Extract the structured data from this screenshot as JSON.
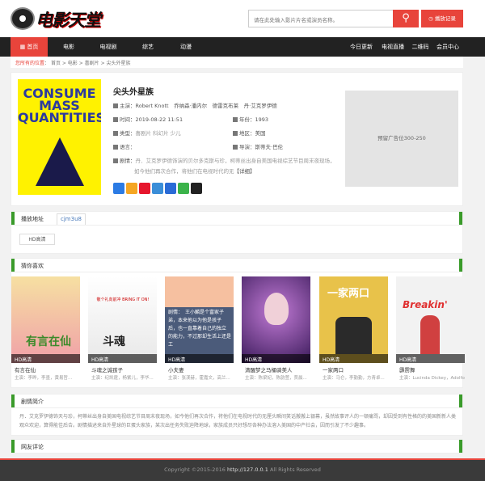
{
  "header": {
    "logo_text": "电影天堂",
    "search_placeholder": "请在此处输入影片片名或演员名称。",
    "history_label": "播放记录"
  },
  "nav": {
    "left": [
      "首页",
      "电影",
      "电视剧",
      "综艺",
      "动漫"
    ],
    "right": [
      "今日更新",
      "电视直播",
      "二维码",
      "会员中心"
    ]
  },
  "breadcrumb": {
    "lead": "您所有的位置",
    "items": [
      "首页",
      "电影",
      "喜剧片",
      "尖头外星族"
    ]
  },
  "movie": {
    "title": "尖头外星族",
    "poster_text": "CONSUME MASS QUANTITIES!",
    "cast_label": "主演：",
    "cast": "Robert Knott　乔纳森·潘内尔　德雷克布莱　丹·艾克罗伊德",
    "time_label": "时间：",
    "time": "2019-08-22 11:51",
    "year_label": "年份：",
    "year": "1993",
    "type_label": "类型：",
    "type": "喜剧片 科幻片 少儿",
    "area_label": "地区：",
    "area": "美国",
    "lang_label": "语言：",
    "lang": "",
    "director_label": "导演：",
    "director": "斯蒂夫·巴伦",
    "plot_label": "剧情：",
    "plot_short": "丹．艾克罗伊德饰演的贝尔多克斯与珍，柯蒂丝出身自美国电视综艺节目周末夜现场，",
    "plot_short2": "如今他们再次合作，将他们在电视时代的无",
    "detail_link": "【详细】",
    "ad_text": "预留广告位300-250"
  },
  "play": {
    "heading": "播放地址",
    "tab": "cjm3u8",
    "episode": "HD高清"
  },
  "recommend": {
    "heading": "猜你喜欢",
    "items": [
      {
        "name": "有言在仙",
        "cast": "主演：李晔，李墨，黄易哲...",
        "label": "HD高清"
      },
      {
        "name": "斗魂之诚孩子",
        "cast": "主演：纪凯霆，杨紫儿，李华...",
        "label": "HD高清"
      },
      {
        "name": "小夫妻",
        "cast": "主演：张渼赫，霍嘉文，高兰...",
        "label": "HD高清"
      },
      {
        "name": "清醒梦之马桶骑美人",
        "cast": "主演：陈梁妃，陈韵萱，贾晨...",
        "label": "HD高清"
      },
      {
        "name": "一家两口",
        "cast": "主演：马仑，李勤勤，方青卓...",
        "label": "HD高清"
      },
      {
        "name": "霹雳舞",
        "cast": "主演：Lucinda Dickey，Adolfo...",
        "label": "HD高清"
      }
    ],
    "overlay3": [
      "剧情：　王小麟是个富家子弟，本来他以为他是孩子",
      "后，也一直靠着自己的独立",
      "的能力，不过那却生活上还是",
      "工"
    ],
    "overlay2": "敬个礼向前冲 BRING IT ON!"
  },
  "synopsis": {
    "heading": "剧情简介",
    "text": "丹．艾克罗伊德饰天与珍，柯蒂丝出身自美国电视综艺节目周末夜现场，如今他们再次合作，将他们在电视时代的无厘头瞬间笑话搬搬上银幕，虽然故事评人的一顿痛骂，却因受到有性格的的美国新新人类观众欢迎，算得能佳后合。剧情描述来自外星球的巨蛋头家族，某次出任务失败迫降地球，家族成员只好想尽各种办法溶入美国的中产社会，因而引发了不少趣事。"
  },
  "comments": {
    "heading": "网友评论"
  },
  "footer": {
    "copyright": "Copyright ©2015-2016",
    "domain": "http://127.0.0.1",
    "rights": "All Rights Reserved"
  }
}
